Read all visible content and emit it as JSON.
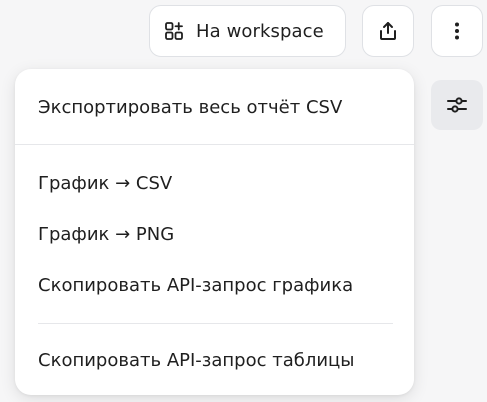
{
  "toolbar": {
    "workspace_label": "На workspace",
    "workspace_icon": "grid-plus-icon",
    "share_icon": "share-upload-icon",
    "more_icon": "vertical-dots-icon",
    "filter_icon": "sliders-icon"
  },
  "menu": {
    "items": [
      {
        "label": "Экспортировать весь отчёт CSV"
      },
      {
        "label": "График → CSV"
      },
      {
        "label": "График → PNG"
      },
      {
        "label": "Скопировать API-запрос графика"
      },
      {
        "label": "Скопировать API-запрос таблицы"
      }
    ]
  },
  "colors": {
    "page_background": "#f6f6f7",
    "surface": "#ffffff",
    "text": "#1f1f1f",
    "filter_button_bg": "#e9eaed"
  }
}
